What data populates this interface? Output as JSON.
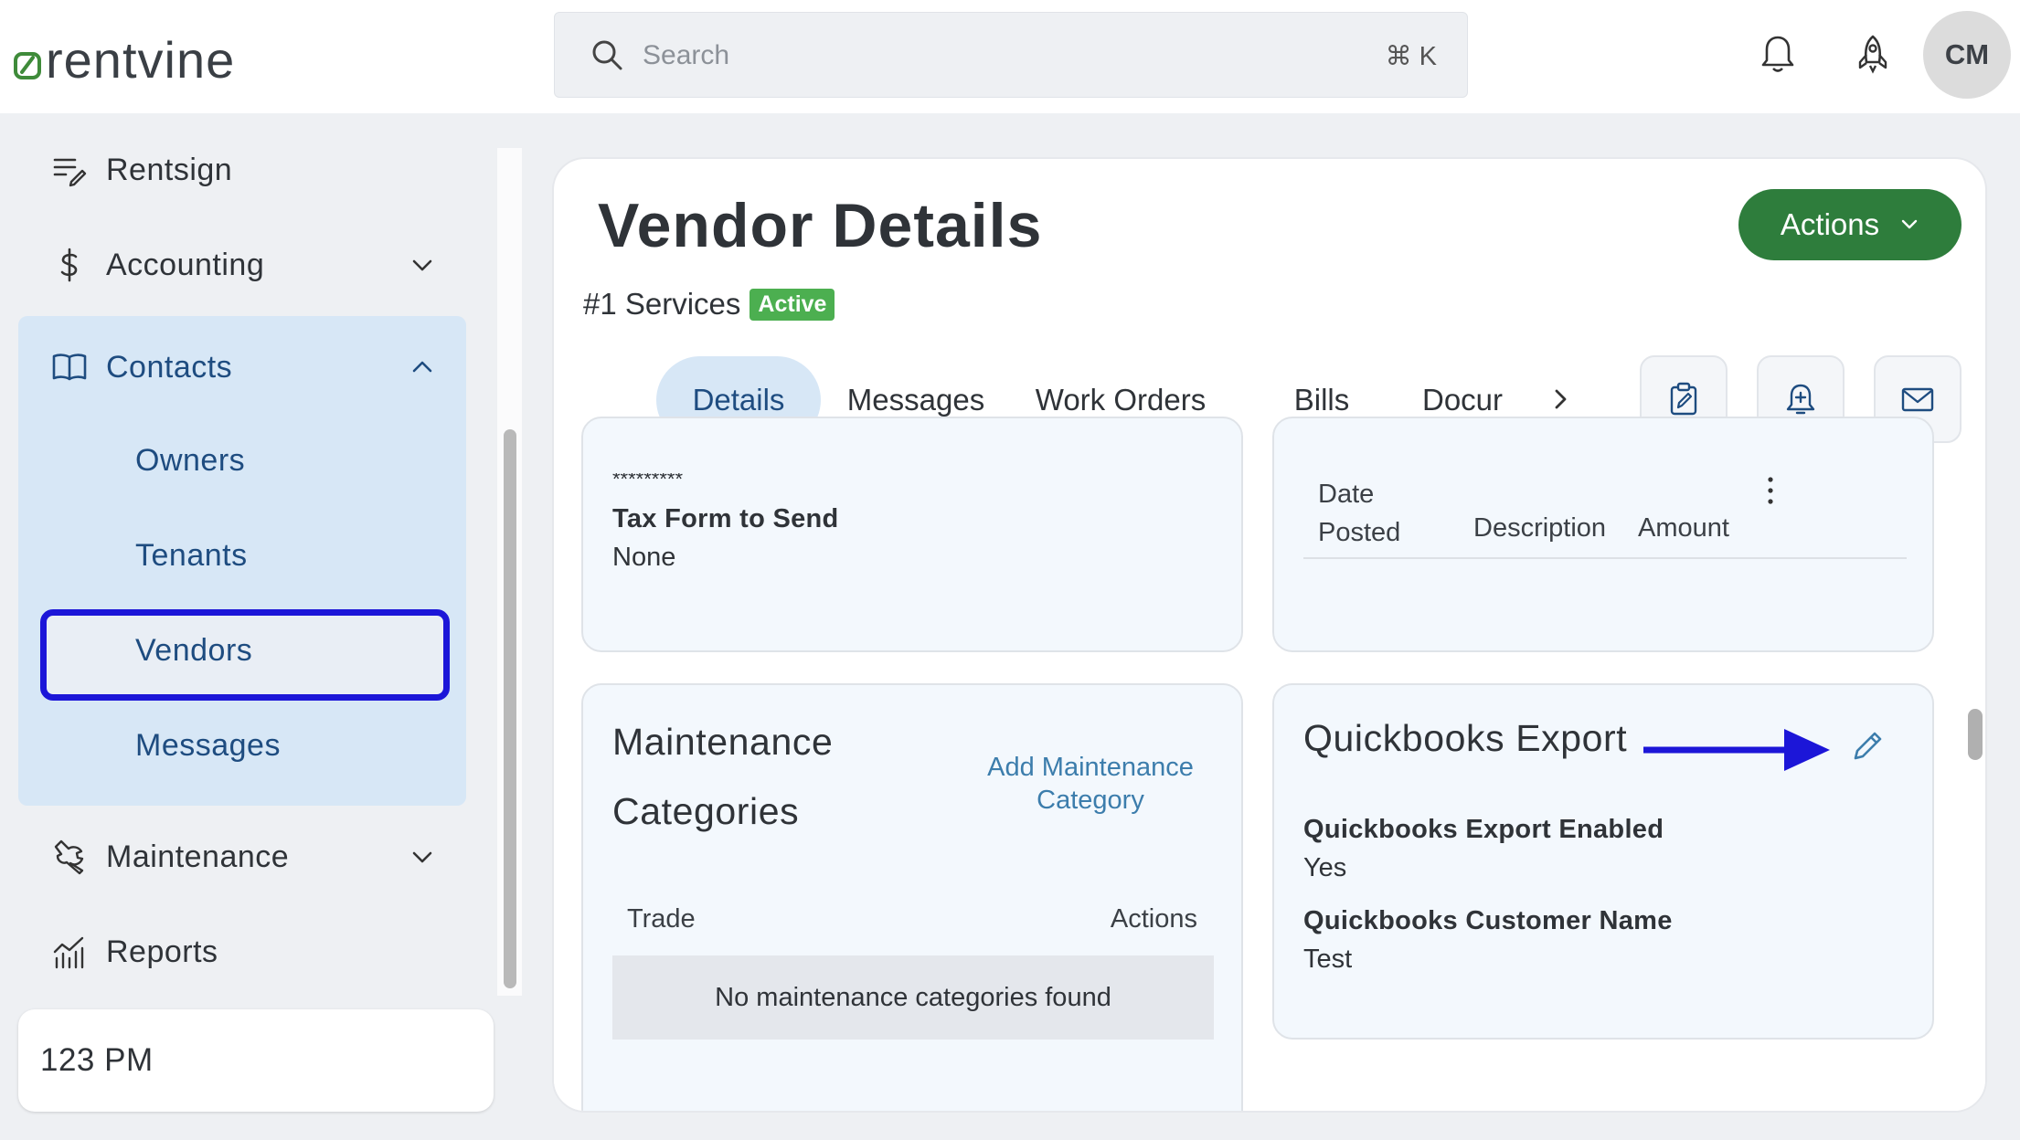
{
  "brand": {
    "logo_text": "rentvine",
    "accent": "#2e7d3c"
  },
  "search": {
    "placeholder": "Search",
    "shortcut": "⌘ K"
  },
  "header": {
    "icons": [
      "bell-icon",
      "rocket-icon"
    ],
    "avatar_initials": "CM"
  },
  "sidebar": {
    "items": [
      {
        "label": "Rentsign",
        "icon": "sign-icon"
      },
      {
        "label": "Accounting",
        "icon": "dollar-icon"
      },
      {
        "label": "Contacts",
        "icon": "book-icon"
      },
      {
        "label": "Maintenance",
        "icon": "wrench-icon"
      },
      {
        "label": "Reports",
        "icon": "chart-icon"
      }
    ],
    "contacts_sub": [
      "Owners",
      "Tenants",
      "Vendors",
      "Messages"
    ],
    "selected": "Vendors",
    "portfolio_label": "123 PM"
  },
  "main": {
    "title": "Vendor Details",
    "actions_label": "Actions",
    "vendor_name": "#1 Services",
    "status": "Active",
    "tabs": [
      "Details",
      "Messages",
      "Work Orders",
      "Bills",
      "Docur"
    ],
    "active_tab": "Details",
    "tab_actions": [
      "clipboard-edit-icon",
      "bell-plus-icon",
      "mail-icon"
    ],
    "tax_card": {
      "masked_value": "*********",
      "label": "Tax Form to Send",
      "value": "None"
    },
    "transactions_card": {
      "columns": [
        "Date\nPosted",
        "Description",
        "Amount"
      ]
    },
    "maintenance_card": {
      "title": "Maintenance Categories",
      "add_link": "Add Maintenance Category",
      "columns": [
        "Trade",
        "Actions"
      ],
      "empty_message": "No maintenance categories found"
    },
    "quickbooks_card": {
      "title": "Quickbooks Export",
      "fields": [
        {
          "label": "Quickbooks Export Enabled",
          "value": "Yes"
        },
        {
          "label": "Quickbooks Customer Name",
          "value": "Test"
        }
      ]
    }
  },
  "annotation": {
    "arrow_color": "#1c16d8"
  }
}
